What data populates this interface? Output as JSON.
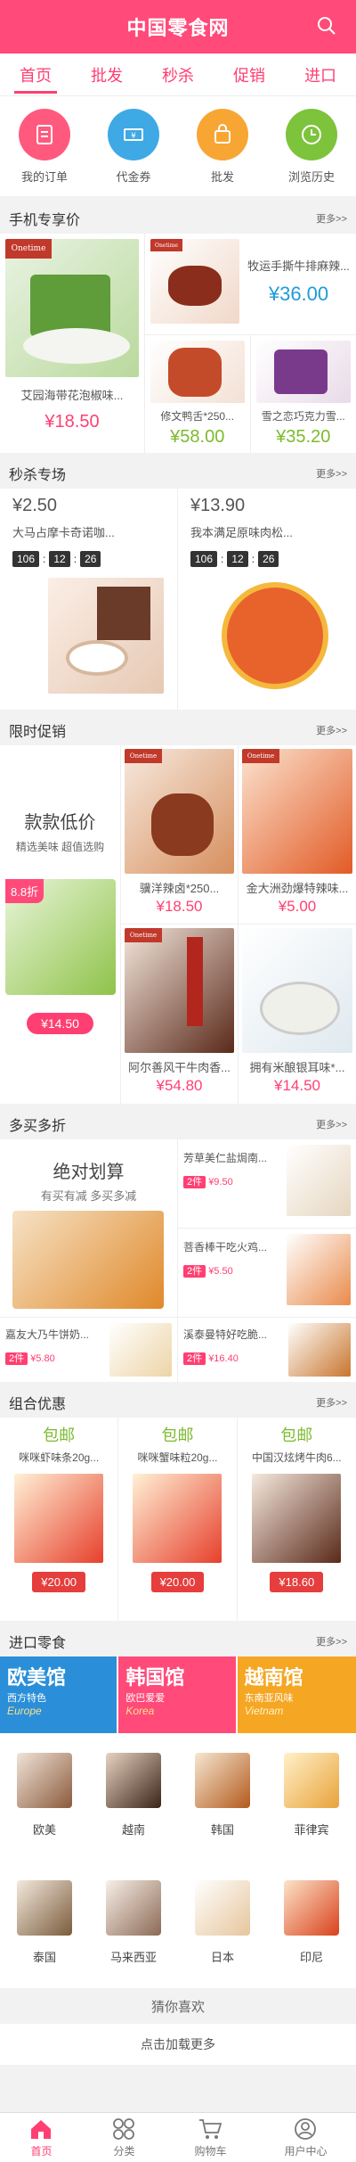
{
  "header": {
    "title": "中国零食网",
    "search_icon": "search-icon"
  },
  "nav": [
    "首页",
    "批发",
    "秒杀",
    "促销",
    "进口"
  ],
  "quick": [
    {
      "label": "我的订单",
      "icon": "order-icon",
      "color": "#ff5a7e"
    },
    {
      "label": "代金券",
      "icon": "coupon-icon",
      "color": "#3fa9e6"
    },
    {
      "label": "批发",
      "icon": "bag-icon",
      "color": "#f7a634"
    },
    {
      "label": "浏览历史",
      "icon": "clock-icon",
      "color": "#7dc33b"
    }
  ],
  "mobile_price": {
    "title": "手机专享价",
    "more": "更多>>",
    "main": {
      "name": "艾园海带花泡椒味...",
      "price": "¥18.50"
    },
    "top_right": {
      "name": "牧运手撕牛排麻辣...",
      "price": "¥36.00"
    },
    "bottom": [
      {
        "name": "修文鸭舌*250...",
        "price": "¥58.00"
      },
      {
        "name": "雪之恋巧克力雪...",
        "price": "¥35.20"
      }
    ]
  },
  "flash": {
    "title": "秒杀专场",
    "more": "更多>>",
    "items": [
      {
        "price": "¥2.50",
        "name": "大马占摩卡奇诺咖...",
        "timer": [
          "106",
          "12",
          "26"
        ]
      },
      {
        "price": "¥13.90",
        "name": "我本满足原味肉松...",
        "timer": [
          "106",
          "12",
          "26"
        ]
      }
    ]
  },
  "promo": {
    "title": "限时促销",
    "more": "更多>>",
    "left": {
      "headline": "款款低价",
      "sub": "精选美味  超值选购",
      "discount": "8.8折",
      "price": "¥14.50"
    },
    "items": [
      {
        "name": "骥洋辣卤*250...",
        "price": "¥18.50"
      },
      {
        "name": "金大洲劲爆特辣味...",
        "price": "¥5.00"
      },
      {
        "name": "阿尔善风干牛肉香...",
        "price": "¥54.80"
      },
      {
        "name": "拥有米酿银耳味*...",
        "price": "¥14.50"
      }
    ]
  },
  "multibuy": {
    "title": "多买多折",
    "more": "更多>>",
    "left": {
      "headline": "绝对划算",
      "sub": "有买有减  多买多减"
    },
    "right": [
      {
        "name": "芳草美仁盐焗南...",
        "tag": "2件",
        "price": "¥9.50"
      },
      {
        "name": "菩香棒干吃火鸡...",
        "tag": "2件",
        "price": "¥5.50"
      }
    ],
    "bottom": [
      {
        "name": "嘉友大乃牛饼奶...",
        "tag": "2件",
        "price": "¥5.80"
      },
      {
        "name": "溪泰曼特好吃脆...",
        "tag": "2件",
        "price": "¥16.40"
      }
    ]
  },
  "combo": {
    "title": "组合优惠",
    "more": "更多>>",
    "items": [
      {
        "tag": "包邮",
        "name": "咪咪虾味条20g...",
        "price": "¥20.00"
      },
      {
        "tag": "包邮",
        "name": "咪咪蟹味粒20g...",
        "price": "¥20.00"
      },
      {
        "tag": "包邮",
        "name": "中国汉炫烤牛肉6...",
        "price": "¥18.60"
      }
    ]
  },
  "imported": {
    "title": "进口零食",
    "more": "更多>>",
    "banners": [
      {
        "big": "欧美馆",
        "sub": "西方特色",
        "en": "Europe",
        "color": "#2a8fd8"
      },
      {
        "big": "韩国馆",
        "sub": "欧巴爱爱",
        "en": "Korea",
        "color": "#ff4a7a"
      },
      {
        "big": "越南馆",
        "sub": "东南亚风味",
        "en": "Vietnam",
        "color": "#f5a623"
      }
    ],
    "countries": [
      "欧美",
      "越南",
      "韩国",
      "菲律宾",
      "泰国",
      "马来西亚",
      "日本",
      "印尼"
    ]
  },
  "guess": {
    "title": "猜你喜欢",
    "load_more": "点击加载更多"
  },
  "tabbar": [
    {
      "label": "首页",
      "icon": "home-icon"
    },
    {
      "label": "分类",
      "icon": "category-icon"
    },
    {
      "label": "购物车",
      "icon": "cart-icon"
    },
    {
      "label": "用户中心",
      "icon": "user-icon"
    }
  ],
  "colors": {
    "brand": "#ff4a7a",
    "green": "#7cba2f",
    "blue": "#1e9bd9"
  }
}
